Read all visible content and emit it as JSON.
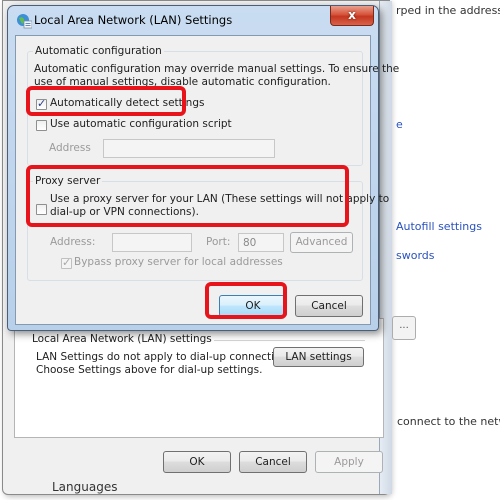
{
  "background": {
    "right_texts": [
      {
        "text": "rped in the address bar",
        "kind": "plain"
      },
      {
        "text": "e",
        "kind": "link"
      },
      {
        "text": "Autofill settings",
        "kind": "link"
      },
      {
        "text": "swords",
        "kind": "link"
      },
      {
        "text": "connect to the netwo",
        "kind": "plain"
      }
    ],
    "side_button_label": "...",
    "languages_label": "Languages"
  },
  "internet_options": {
    "lan_group_title": "Local Area Network (LAN) settings",
    "lan_description_line1": "LAN Settings do not apply to dial-up connections.",
    "lan_description_line2": "Choose Settings above for dial-up settings.",
    "lan_settings_button": "LAN settings",
    "ok_button": "OK",
    "cancel_button": "Cancel",
    "apply_button": "Apply"
  },
  "dialog": {
    "title": "Local Area Network (LAN) Settings",
    "close_label": "x",
    "auto_config": {
      "title": "Automatic configuration",
      "description_line1": "Automatic configuration may override manual settings.  To ensure the",
      "description_line2": "use of manual settings, disable automatic configuration.",
      "auto_detect_label": "Automatically detect settings",
      "auto_detect_checked": true,
      "use_script_label": "Use automatic configuration script",
      "use_script_checked": false,
      "address_label": "Address",
      "address_value": ""
    },
    "proxy": {
      "title": "Proxy server",
      "use_proxy_line1": "Use a proxy server for your LAN (These settings will not apply to",
      "use_proxy_line2": "dial-up or VPN connections).",
      "use_proxy_checked": false,
      "address_label": "Address:",
      "address_value": "",
      "port_label": "Port:",
      "port_value": "80",
      "advanced_button": "Advanced",
      "bypass_label": "Bypass proxy server for local addresses",
      "bypass_checked": true
    },
    "ok_button": "OK",
    "cancel_button": "Cancel"
  },
  "annotations": {
    "highlight_color": "#e8141b"
  }
}
